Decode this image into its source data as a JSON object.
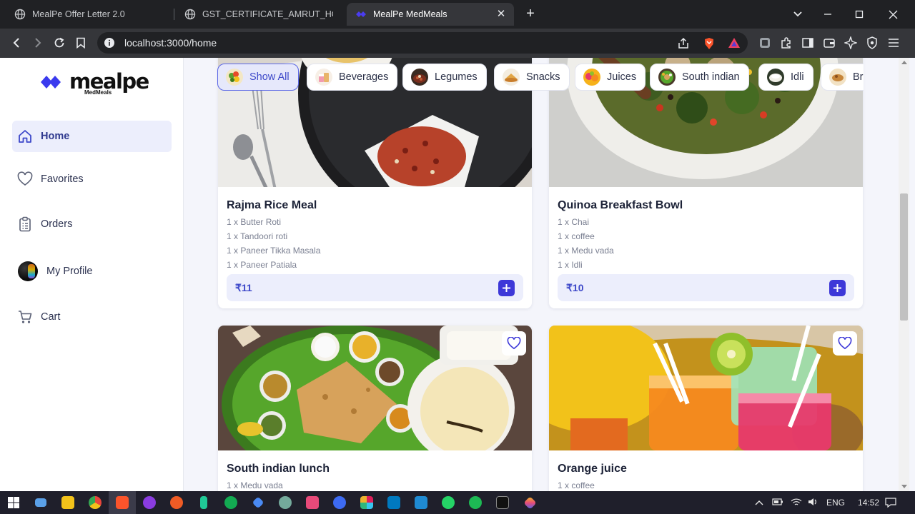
{
  "browser": {
    "tabs": [
      {
        "title": "MealPe Offer Letter 2.0",
        "active": false
      },
      {
        "title": "GST_CERTIFICATE_AMRUT_HOSPITA",
        "active": false
      },
      {
        "title": "MealPe MedMeals",
        "active": true
      }
    ],
    "url": "localhost:3000/home"
  },
  "sidebar": {
    "logo_text": "mealpe",
    "logo_sub": "MedMeals",
    "items": [
      {
        "label": "Home",
        "icon": "home-icon",
        "active": true
      },
      {
        "label": "Favorites",
        "icon": "heart-icon",
        "active": false
      },
      {
        "label": "Orders",
        "icon": "clipboard-icon",
        "active": false
      },
      {
        "label": "My Profile",
        "icon": "avatar",
        "active": false
      },
      {
        "label": "Cart",
        "icon": "cart-icon",
        "active": false
      }
    ]
  },
  "categories": [
    {
      "label": "Show All",
      "active": true
    },
    {
      "label": "Beverages",
      "active": false
    },
    {
      "label": "Legumes",
      "active": false
    },
    {
      "label": "Snacks",
      "active": false
    },
    {
      "label": "Juices",
      "active": false
    },
    {
      "label": "South indian",
      "active": false
    },
    {
      "label": "Idli",
      "active": false
    },
    {
      "label": "Br",
      "active": false
    }
  ],
  "meals": [
    {
      "name": "Rajma Rice Meal",
      "items": [
        "1 x Butter Roti",
        "1 x Tandoori roti",
        "1 x Paneer Tikka Masala",
        "1 x Paneer Patiala"
      ],
      "price": "₹11"
    },
    {
      "name": "Quinoa Breakfast Bowl",
      "items": [
        "1 x Chai",
        "1 x coffee",
        "1 x Medu vada",
        "1 x Idli"
      ],
      "price": "₹10"
    },
    {
      "name": "South indian lunch",
      "items": [
        "1 x Medu vada"
      ],
      "price": ""
    },
    {
      "name": "Orange juice",
      "items": [
        "1 x coffee"
      ],
      "price": ""
    }
  ],
  "taskbar": {
    "lang": "ENG",
    "time": "14:52"
  },
  "colors": {
    "accent": "#3d38d8",
    "accent_soft": "#eceefc",
    "page_bg": "#f4f5fb",
    "logo": "#3a3aee"
  }
}
